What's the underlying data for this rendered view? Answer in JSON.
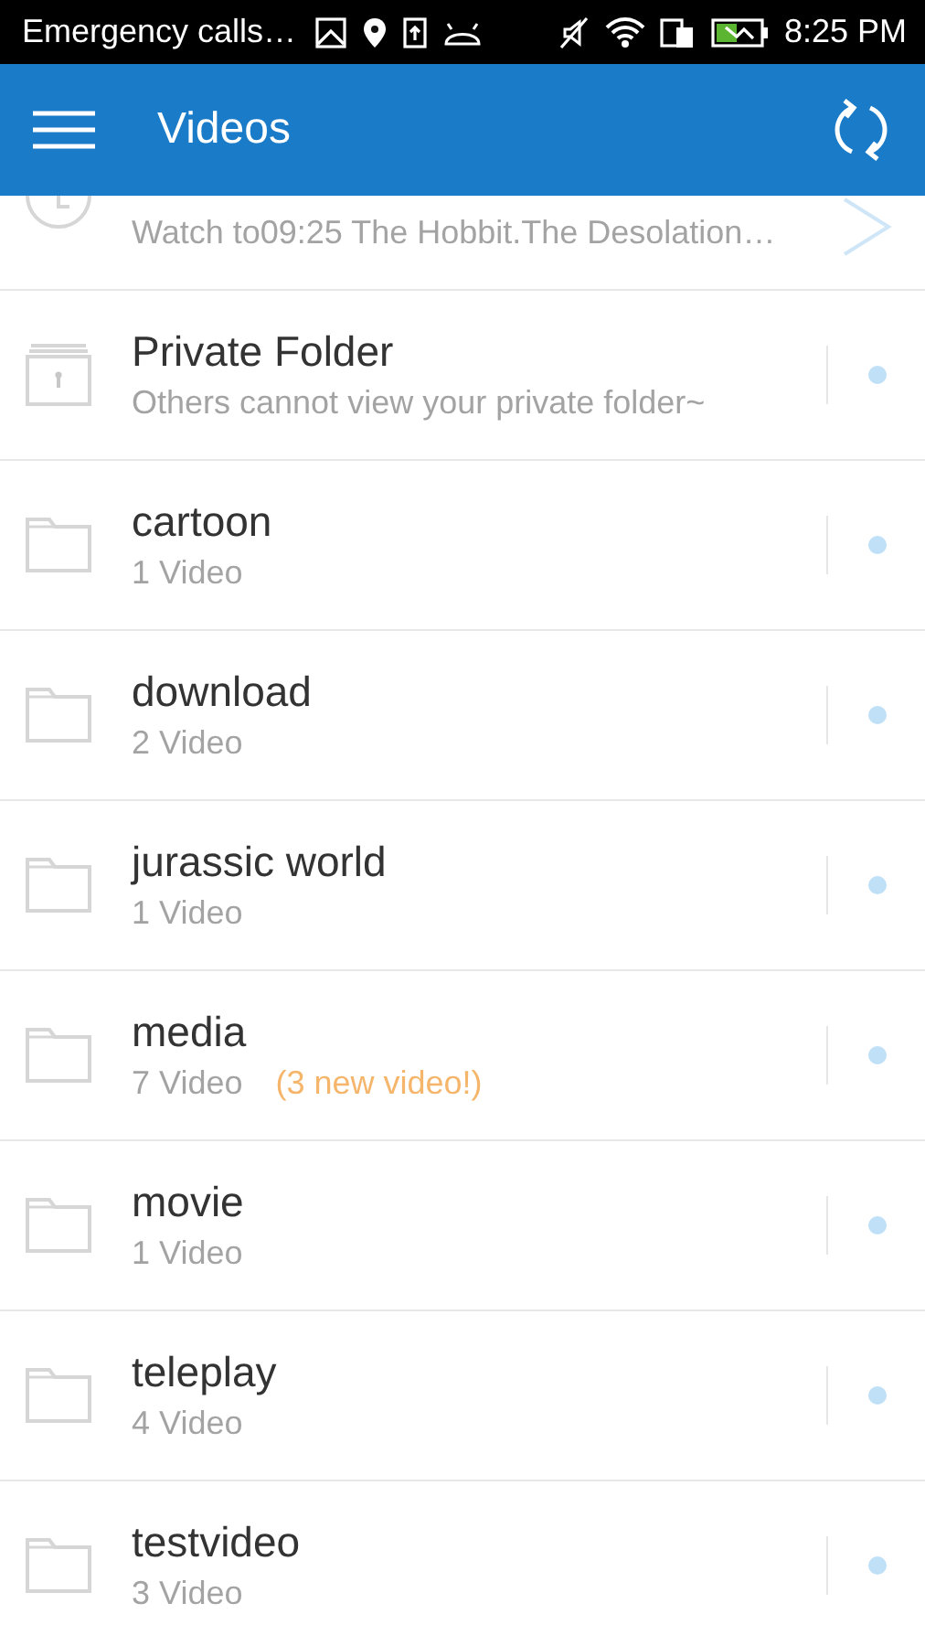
{
  "status_bar": {
    "carrier": "Emergency calls…",
    "time": "8:25 PM"
  },
  "app_bar": {
    "title": "Videos"
  },
  "history": {
    "subtitle": "Watch to09:25 The Hobbit.The Desolation…"
  },
  "folders": [
    {
      "kind": "private",
      "name": "Private Folder",
      "detail": "Others cannot view your private folder~"
    },
    {
      "kind": "folder",
      "name": "cartoon",
      "detail": "1 Video"
    },
    {
      "kind": "folder",
      "name": "download",
      "detail": "2 Video"
    },
    {
      "kind": "folder",
      "name": "jurassic world",
      "detail": "1 Video"
    },
    {
      "kind": "folder",
      "name": "media",
      "detail": "7 Video",
      "note": "(3 new video!)"
    },
    {
      "kind": "folder",
      "name": "movie",
      "detail": "1 Video"
    },
    {
      "kind": "folder",
      "name": "teleplay",
      "detail": "4 Video"
    },
    {
      "kind": "folder",
      "name": "testvideo",
      "detail": "3 Video"
    }
  ]
}
